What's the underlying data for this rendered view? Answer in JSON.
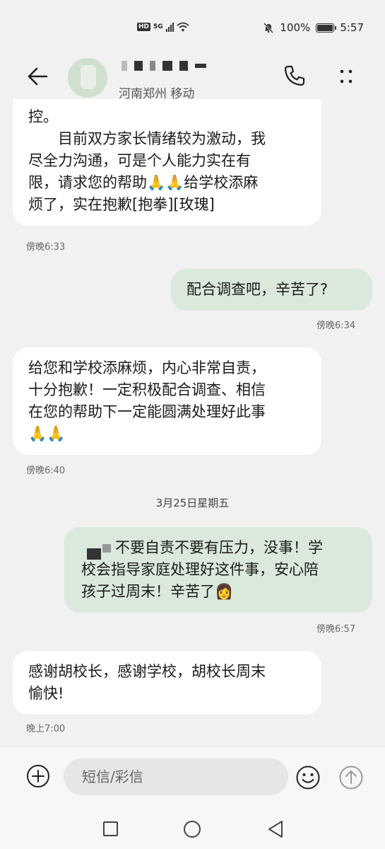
{
  "status": {
    "network": "HD",
    "network_type": "5G",
    "battery": "100%",
    "time": "5:57"
  },
  "header": {
    "contact_sub": "河南郑州 移动",
    "icons": [
      "back-arrow-icon",
      "phone-icon",
      "more-icon"
    ]
  },
  "messages": [
    {
      "dir": "in",
      "lines": [
        "控。",
        "　　目前双方家长情绪较为激动，我",
        "尽全力沟通，可是个人能力实在有",
        "限，请求您的帮助🙏🙏给学校添麻",
        "烦了，实在抱歉[抱拳][玫瑰]"
      ],
      "time": "傍晚6:33"
    },
    {
      "dir": "out",
      "lines": [
        "配合调查吧，辛苦了?"
      ],
      "time": "傍晚6:34"
    },
    {
      "dir": "in",
      "lines": [
        "给您和学校添麻烦，内心非常自责，",
        "十分抱歉！一定积极配合调查、相信",
        "在您的帮助下一定能圆满处理好此事",
        "🙏🙏"
      ],
      "time": "傍晚6:40"
    },
    {
      "dir": "out",
      "lines": [
        "不要自责不要有压力，没事！学",
        "校会指导家庭处理好这件事，安心陪",
        "孩子过周末！辛苦了👩"
      ],
      "time": "傍晚6:57"
    },
    {
      "dir": "in",
      "lines": [
        "感谢胡校长，感谢学校，胡校长周末",
        "愉快!"
      ],
      "time": "晚上7:00"
    }
  ],
  "date_separator": "3月25日星期五",
  "input": {
    "placeholder": "短信/彩信"
  },
  "colors": {
    "incoming_bubble": "#ffffff",
    "outgoing_bubble": "#dbe9dc",
    "background": "#f1f1f1"
  }
}
